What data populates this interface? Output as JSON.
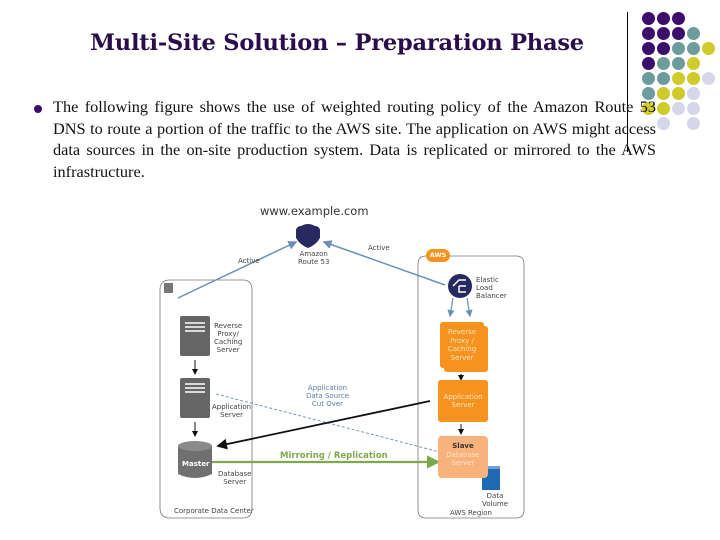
{
  "slide": {
    "title": "Multi-Site Solution – Preparation Phase",
    "bullet_text": "The following figure shows the use of weighted routing policy of the Amazon Route 53 DNS to route a portion of the traffic to the AWS site. The application on AWS might access data sources in the on-site production system. Data is replicated or mirrored to the AWS infrastructure."
  },
  "decoration": {
    "dot_colors": {
      "purple": "#3b0e6e",
      "teal": "#6e9c9c",
      "yellow": "#cfcb2a",
      "lavender": "#d6d6ea"
    },
    "dot_grid": [
      [
        "purple",
        "purple",
        "purple",
        null,
        null
      ],
      [
        "purple",
        "purple",
        "purple",
        "teal",
        null
      ],
      [
        "purple",
        "purple",
        "teal",
        "teal",
        "yellow"
      ],
      [
        "purple",
        "teal",
        "teal",
        "yellow",
        null
      ],
      [
        "teal",
        "teal",
        "yellow",
        "yellow",
        "lavender"
      ],
      [
        "teal",
        "yellow",
        "yellow",
        "lavender",
        null
      ],
      [
        "yellow",
        "yellow",
        "lavender",
        "lavender",
        null
      ],
      [
        null,
        "lavender",
        null,
        "lavender",
        null
      ]
    ]
  },
  "figure": {
    "domain_label": "www.example.com",
    "route53_label_1": "Amazon",
    "route53_label_2": "Route 53",
    "active_left": "Active",
    "active_right": "Active",
    "aws_badge": "AWS",
    "elb_label_1": "Elastic",
    "elb_label_2": "Load",
    "elb_label_3": "Balancer",
    "onsite": {
      "proxy_label": [
        "Reverse",
        "Proxy/",
        "Caching",
        "Server"
      ],
      "app_label": [
        "Application",
        "Server"
      ],
      "db_name": "Master",
      "db_label": [
        "Database",
        "Server"
      ],
      "region_label": "Corporate Data Center"
    },
    "aws": {
      "proxy_label": [
        "Reverse",
        "Proxy /",
        "Caching",
        "Server"
      ],
      "app_label": [
        "Application",
        "Server"
      ],
      "db_name": "Slave",
      "db_label": [
        "Database",
        "Server"
      ],
      "volume_label": [
        "Data",
        "Volume"
      ],
      "region_label": "AWS Region"
    },
    "failover_label": [
      "Application",
      "Data Source",
      "Cut Over"
    ],
    "mirror_label": "Mirroring / Replication"
  }
}
